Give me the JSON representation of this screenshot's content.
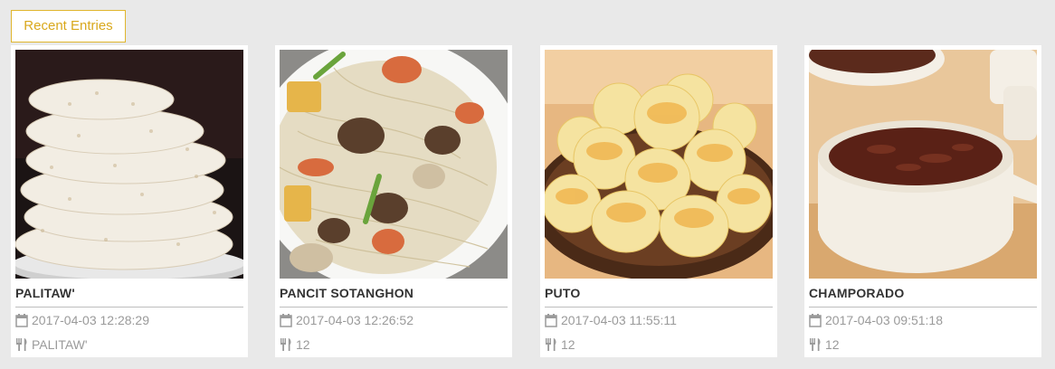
{
  "section": {
    "tab_label": "Recent Entries"
  },
  "colors": {
    "accent": "#d9a81c",
    "page_background": "#e9e9e9",
    "card_background": "#ffffff",
    "meta_text": "#9a9a9a",
    "title_text": "#333333"
  },
  "entries": [
    {
      "title": "PALITAW'",
      "date": "2017-04-03 12:28:29",
      "info": "PALITAW'",
      "image": "coconut-rice-cake-photo"
    },
    {
      "title": "PANCIT SOTANGHON",
      "date": "2017-04-03 12:26:52",
      "info": "12",
      "image": "noodles-with-shrimp-photo"
    },
    {
      "title": "PUTO",
      "date": "2017-04-03 11:55:11",
      "info": "12",
      "image": "steamed-rice-cakes-photo"
    },
    {
      "title": "CHAMPORADO",
      "date": "2017-04-03 09:51:18",
      "info": "12",
      "image": "chocolate-rice-porridge-photo"
    }
  ]
}
